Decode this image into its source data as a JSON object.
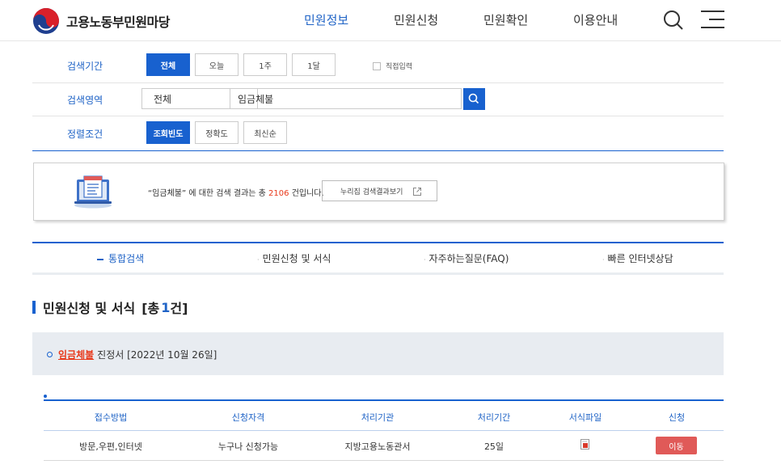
{
  "header": {
    "logo_text": "고용노동부민원마당",
    "nav": [
      {
        "label": "민원정보",
        "active": true
      },
      {
        "label": "민원신청",
        "active": false
      },
      {
        "label": "민원확인",
        "active": false
      },
      {
        "label": "이용안내",
        "active": false
      }
    ],
    "search_icon": "search-icon",
    "menu_icon": "hamburger-menu-icon"
  },
  "filters": {
    "period": {
      "label": "검색기간",
      "options": [
        "전체",
        "오늘",
        "1주",
        "1달"
      ],
      "selected": "전체",
      "direct_input_label": "직접입력"
    },
    "area": {
      "label": "검색영역",
      "select_value": "전체",
      "query": "임금체불"
    },
    "sort": {
      "label": "정렬조건",
      "options": [
        "조회빈도",
        "정확도",
        "최신순"
      ],
      "selected": "조회빈도"
    }
  },
  "result_summary": {
    "prefix": "“임금체불” 에 대한 검색 결과는 총",
    "count": "2106",
    "suffix": "건입니다.",
    "external_button": "누리집 검색결과보기"
  },
  "tabs": [
    {
      "label": "통합검색",
      "active": true
    },
    {
      "label": "민원신청 및 서식",
      "active": false
    },
    {
      "label": "자주하는질문(FAQ)",
      "active": false
    },
    {
      "label": "빠른 인터넷상담",
      "active": false
    }
  ],
  "section": {
    "title": "민원신청 및 서식",
    "count_open": "[총",
    "count": "1",
    "count_close": "건]"
  },
  "item": {
    "keyword": "임금체불",
    "title_rest": "진정서 [2022년 10월 26일]"
  },
  "table": {
    "headers": [
      "접수방법",
      "신청자격",
      "처리기관",
      "처리기간",
      "서식파일",
      "신청"
    ],
    "rows": [
      {
        "method": "방문,우편,인터넷",
        "eligibility": "누구나 신청가능",
        "agency": "지방고용노동관서",
        "period": "25일",
        "file_icon": "document-file-icon",
        "action": "이동"
      }
    ]
  },
  "colors": {
    "primary": "#1861cf",
    "highlight": "#e8381a",
    "action": "#e05a58"
  }
}
